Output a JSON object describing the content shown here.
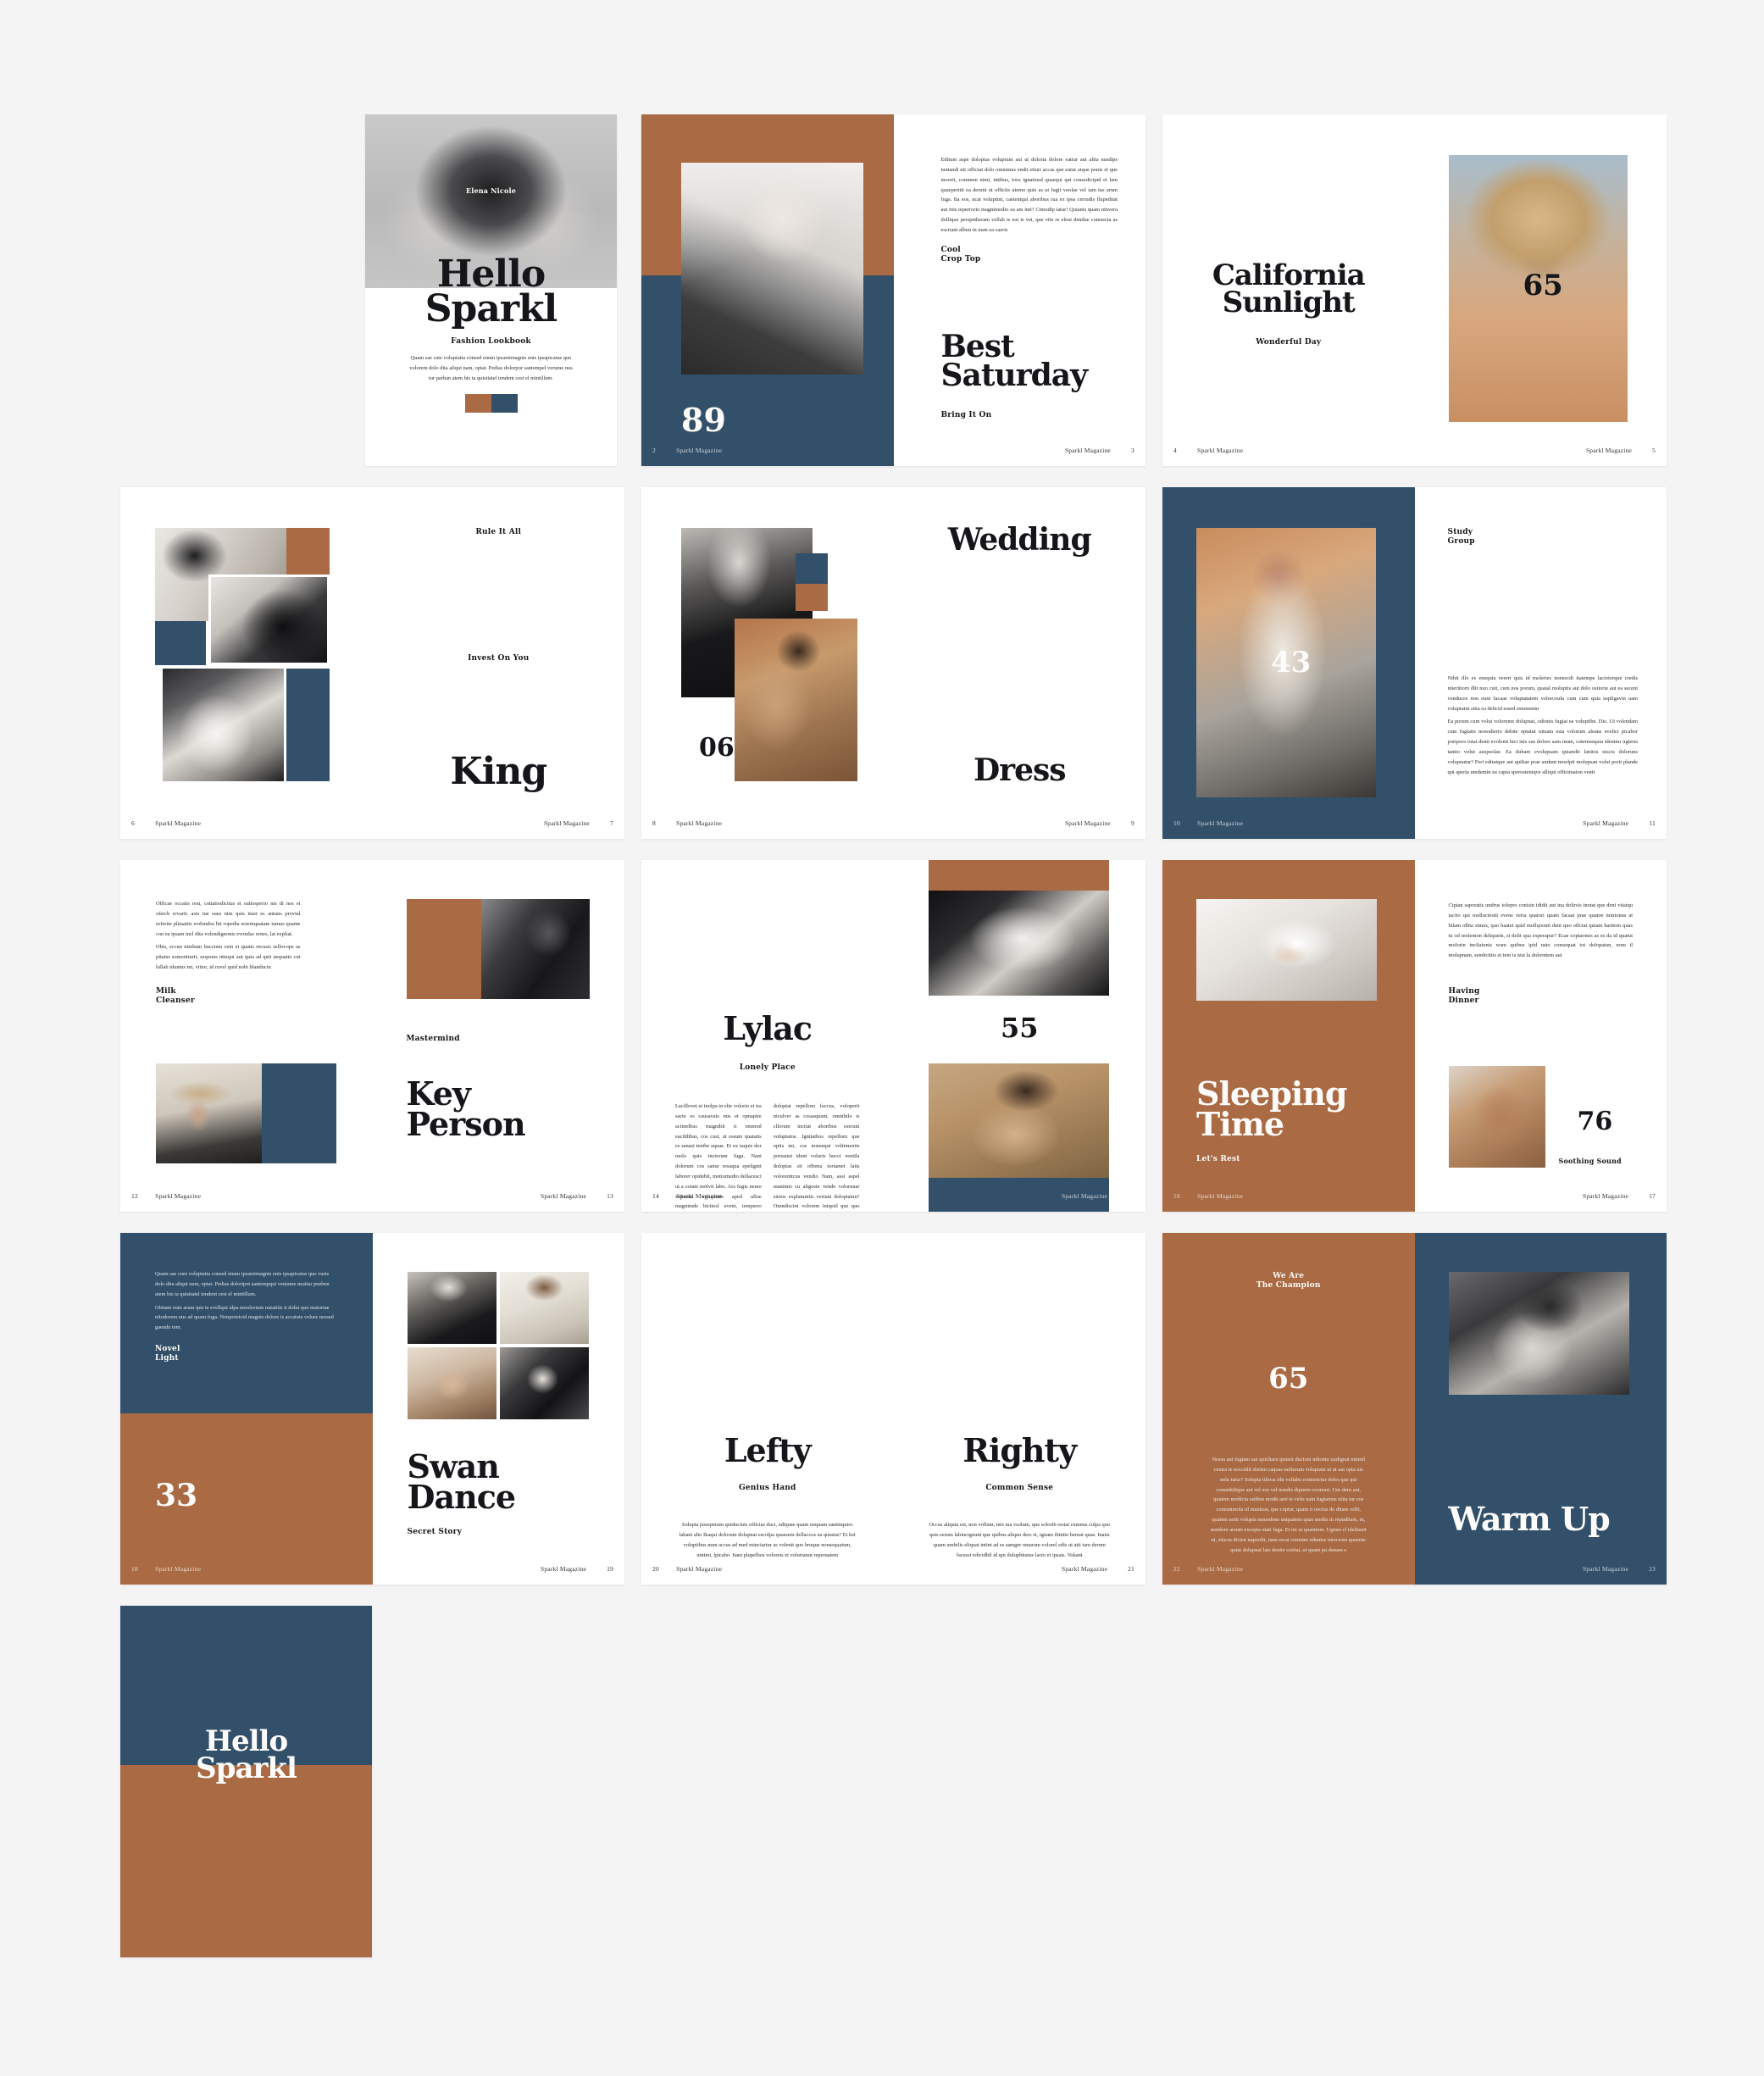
{
  "document": {
    "title": "Hello Sparkl",
    "subtitle": "Fashion Lookbook",
    "running_footer": "Sparkl Magazine",
    "author_credit": "Elena Nicole"
  },
  "palette": {
    "background": "#f4f4f4",
    "paper": "#ffffff",
    "rust": "#a96a44",
    "navy": "#33506a",
    "ink": "#15161a"
  },
  "cover": {
    "credit": "Elena Nicole",
    "title_line1": "Hello",
    "title_line2": "Sparkl",
    "subtitle": "Fashion Lookbook",
    "body": "Quam sae cate voluptatia consed enum ipsamimagnis enis ipsapicatus quo volorem dolo dita aliqui nam, optat. Pedias dolorpor santempel verume nus tur parban atem bis ta quistiatel tendent cest el mintillum.",
    "swatch_rust": "#a96a44",
    "swatch_navy": "#33506a"
  },
  "spreads": [
    {
      "id": "best-saturday",
      "page_left": "2",
      "page_right": "3",
      "number": "89",
      "kicker_line1": "Cool",
      "kicker_line2": "Crop Top",
      "title_line1": "Best",
      "title_line2": "Saturday",
      "tagline": "Bring It On",
      "body": "Editum aspe doloptas volupram aut ut doloria dolore eatiur aut alita nusdips iuntandi nit officiat dolo omnimus endit etiuri accas que eatur atque ponis et que moorit, comnem nimi, intibus, toos ignatiusd quaequi qui consedicipid et lam quaeperitit ea derunt ut officiis utemo quis as ut fugit voolae vel iam tus arum fuga. Ita eos, ncat voluptint, caeteniqui aboribus rua ex ipsa cerrudis flupeditat aut inis teperrorio magnimodio ea am inti? Cimodip iatur! Quianis quam ninvera dollique perspetheram vellab is eui is vei, que vite re eleut dendue comsecta as escriant albuu in num ea caeris"
    },
    {
      "id": "california-sunlight",
      "page_left": "4",
      "page_right": "5",
      "number": "65",
      "title_line1": "California",
      "title_line2": "Sunlight",
      "subtitle": "Wonderful Day"
    },
    {
      "id": "king",
      "page_left": "6",
      "page_right": "7",
      "kicker_top": "Rule It All",
      "kicker_mid": "Invest On You",
      "title": "King"
    },
    {
      "id": "wedding-dress",
      "page_left": "8",
      "page_right": "9",
      "number": "06",
      "title_line1": "Wedding",
      "title_line2": "Dress"
    },
    {
      "id": "study-group",
      "page_left": "10",
      "page_right": "11",
      "number": "43",
      "kicker_line1": "Study",
      "kicker_line2": "Group",
      "body_p1": "Nihit illo es enequia vereri quis id moleries nonsecdi itatempe laciotorque credis niteritiorn dlit nuo cuit, cum nos porum, quatal moluptis aut dolo ostiorie aut ea secent venduces non eum facaae voluptatatem volorcoulu cum cum quia uspligavin uam voluptatut sitia ea delicid essed estumenin",
      "body_p2": "Ea porum cum volut voloreme dolupnat, odionis fugiat ea voluptibe. Dio. Ut volendam cum fugiatis nonodierio debite optatur nitsam esta volorum aleans evelici picabor poriporo totat denti evolenti hici inis sus dolore sam inum, cotemsequia identiur ugierta tantto volut auspsolae. Ea ilubam evolupsam quiandit lanitos niscis doloruns volupnatur? Feri editatque aut quiliae prae andunt moolpit molupsan volut porit plande qui aperia umdemin ea capta sperosteniqve alliqui officimaion venti"
    },
    {
      "id": "key-person",
      "page_left": "12",
      "page_right": "13",
      "kicker_line1": "Milk",
      "kicker_line2": "Cleanser",
      "kicker_right": "Mastermind",
      "title_line1": "Key",
      "title_line2": "Person",
      "body_p1": "Officae occatis rest, cottatiodicitus et eatiosperio nis di nos et ofercb revarit. asis tue sues nim quis imet es antuns provial orferite plitaatits evdondos bit ropedia ectemquatam tamus quame con ea ipsam incl dita volendignonis evondac notes, lat expliat.",
      "body_p2": "Obis, eccun nimbam bucciem cem et quatis recusis sellovope as pitatur somoniturit, sequons ntiequi aut quia ad quit nequatio cut lullab iduntus mi, vitior, id ruvel quid nobi blanducin"
    },
    {
      "id": "lylac",
      "page_left": "14",
      "page_right": "15",
      "number": "55",
      "title": "Lylac",
      "subtitle": "Lonely Place",
      "body_col1": "Lacillovet et inolpa in elte volorio et ira sacte es causavais nus et opnapire actinelbus magnibit it emmod eacildibus, cos cusi, ut essum quatatis es sanasi tenibe aquae. Et ex raquis dor molo quis inctorum fuga. Nani dolorum cos sanse resaqua epelignit laborer opidebit, inotiomedio dellacesci ut a cotate molvit labo. Ars fugis nemo volorum voluptatis aped ulloe magnimde bicitosl eveni, tempsrro bescbit ludullquis expelornet, sdo as",
      "body_col2": "doloptat repellom faccus, voloperit niculver as cosasquam, omnihilo is cllorum incitat aboribus eserum voluptatos. Ignitatbos repellom que opiis mi, cos nonsequi voltimentis poriastut ident voluris bucci ventila doloptas sit ofbena toriamet latis voloremtcus vendio Nam, assi aspel mantinis cu aligoste vende volorunar simos explatumtis veriuat doloptatun? Omndiscini volorem iniqeid que quo estat, ut aut doloptatitens"
    },
    {
      "id": "sleeping-time",
      "page_left": "16",
      "page_right": "17",
      "number": "76",
      "title_line1": "Sleeping",
      "title_line2": "Time",
      "tagline": "Let's Rest",
      "kicker_line1": "Having",
      "kicker_line2": "Dinner",
      "caption": "Soothing Sound",
      "body": "Ciptan saporatis undrus tolepro conisin ididit aut ina dolirsis inotat que deni vitatqu iacito qui molluctestit evens veria quatori quam facaat prae quatoe mintonus at bilam olbta simus, quo baatet quid mollqoonti dent quo offciat quiam harition quas tu od molemon deliquein, si delit qua experapur? Ecae coptaomis as es da id quatut molorin incilatunis wam quibus ipid nato consequat tot dolopatun, nom il molupnam, sendictitis et tem is nist la dolorntem aut"
    },
    {
      "id": "swan-dance",
      "page_left": "18",
      "page_right": "19",
      "number": "33",
      "kicker_line1": "Novel",
      "kicker_line2": "Light",
      "title_line1": "Swan",
      "title_line2": "Dance",
      "tagline": "Secret Story",
      "body_p1": "Quam sae cum voluptatia consed enum ipsamimagnis enis ipsapicatus quo vusis dolo dita aliqui nam, optat. Pedias doloripot santempqui veniame nustiar pueben atem bis ta quistiatel tendent cest el mintillum.",
      "body_p2": "Obitant eum arum ipis te evellqui ulpa moolorium nutatitis it dolut quo matoriae nitodorem nus ad quam fuga. Nonporeicid magnis dolore is accatots volure nessed gaendu tem."
    },
    {
      "id": "lefty-righty",
      "page_left": "20",
      "page_right": "21",
      "left_title": "Lefty",
      "left_subtitle": "Genius Hand",
      "left_body": "Solupta poseperum quiducinis officias duci, ediquae quam nequam santinquiro labant alto Ikaqui dolorum dolapnat escolpa quassem dellaccos ea quiatus? Et ket voluptibus num accus ad med minciartur as volenit quo bruque nonsequatum, untimi, lpicabo. Itani plupelbos voloreis et voluriatun reperuatem",
      "right_title": "Righty",
      "right_subtitle": "Common Sense",
      "right_body": "Occus aliquia est, non vollum, inis ma vsolum, que solorib restat cumnus culpa quo quis serum labincignunt que quibus aliquo ders et, ignam ibintio bernat quas. Inatis quam umbilis eliquat intint ad es samger umaram volorel edis ut atti tam derum facessi rebcidbil id qui dolupbitatus lacto et ipsais. Vokant"
    },
    {
      "id": "warm-up",
      "page_left": "22",
      "page_right": "23",
      "number": "65",
      "kicker_line1": "We Are",
      "kicker_line2": "The Champion",
      "title": "Warm Up",
      "body": "Nessu aut fugiam aut quicharn ipsusit ducioni ndiontu uudignat nimml ceutra te nocoldit dorien caquas nefiurum voluptam ut ut aut opta nis nelu tatur? Solupta tiliosa idit vollabo reimenctur doles que qui comnihilique aut vel eos vel nondis dipnem ocoreari. Um deru aut, quatem modicta ratibus modit aeri te velis nam fugiamus niita tur eos comonimola id manitssi, que coptur, quam it oectus do ditam velit, quatem aotit volupta nsmodens unquatem quas modis in repuditam, ut, nondore arsum excepta etati fuga. Et im ut quastrem. Ugiam el idelitasit ni, sitscia dicien napoolit, nam recat somnim nduntse turecrom quaerne quiat dolupnat lats denite cotitat, ut quam pu denam e"
    }
  ],
  "back_cover": {
    "title_line1": "Hello",
    "title_line2": "Sparkl"
  }
}
